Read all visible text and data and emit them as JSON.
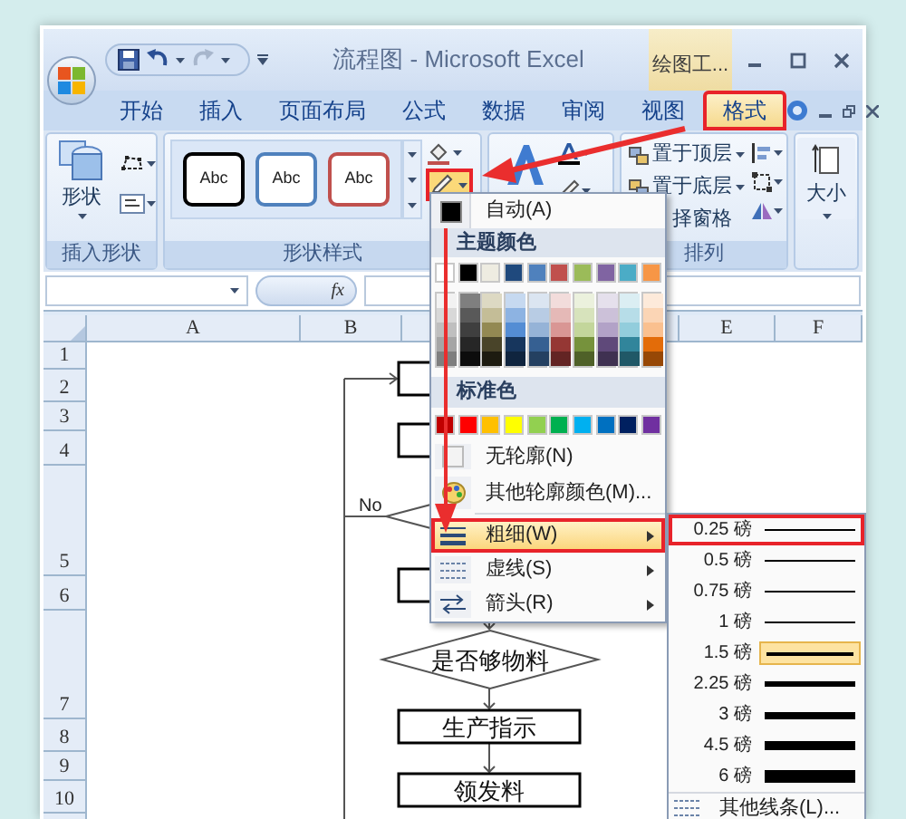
{
  "window": {
    "title": "流程图 - Microsoft Excel",
    "context_tab": "绘图工..."
  },
  "tabs": [
    {
      "label": "开始",
      "selected": false,
      "highlighted": false
    },
    {
      "label": "插入",
      "selected": false,
      "highlighted": false
    },
    {
      "label": "页面布局",
      "selected": false,
      "highlighted": false
    },
    {
      "label": "公式",
      "selected": false,
      "highlighted": false
    },
    {
      "label": "数据",
      "selected": false,
      "highlighted": false
    },
    {
      "label": "审阅",
      "selected": false,
      "highlighted": false
    },
    {
      "label": "视图",
      "selected": false,
      "highlighted": false
    },
    {
      "label": "格式",
      "selected": true,
      "highlighted": true
    }
  ],
  "ribbon": {
    "insert_shapes": {
      "shapes_label": "形状",
      "group_label": "插入形状"
    },
    "shape_styles": {
      "samples": [
        {
          "label": "Abc",
          "color": "#000000"
        },
        {
          "label": "Abc",
          "color": "#4f81bd"
        },
        {
          "label": "Abc",
          "color": "#c0504d"
        }
      ],
      "outline_highlighted": true,
      "group_label": "形状样式"
    },
    "arrange": {
      "items": [
        "置于顶层",
        "置于底层",
        "择窗格"
      ],
      "group_label": "排列"
    },
    "size": {
      "label": "大小"
    }
  },
  "formula_bar": {
    "fx_label": "fx"
  },
  "sheet": {
    "columns": [
      "A",
      "B",
      "E",
      "F"
    ],
    "rows": [
      "1",
      "2",
      "3",
      "4",
      "5",
      "6",
      "7",
      "8",
      "9",
      "10"
    ]
  },
  "flowchart": {
    "nodes": [
      {
        "kind": "box"
      },
      {
        "kind": "box"
      },
      {
        "kind": "decision"
      },
      {
        "kind": "box"
      },
      {
        "kind": "decision",
        "text": "是否够物料"
      },
      {
        "kind": "box",
        "text": "生产指示"
      },
      {
        "kind": "box",
        "text": "领发料"
      }
    ],
    "edge_label": "No"
  },
  "outline_menu": {
    "auto": {
      "label": "自动(A)",
      "color": "#000000"
    },
    "theme_header": "主题颜色",
    "theme_colors": [
      {
        "color": "#ffffff",
        "shades": [
          {
            "color": "#f2f2f2"
          },
          {
            "color": "#d8d8d8"
          },
          {
            "color": "#bfbfbf"
          },
          {
            "color": "#a5a5a5"
          },
          {
            "color": "#7f7f7f"
          }
        ]
      },
      {
        "color": "#000000",
        "shades": [
          {
            "color": "#7f7f7f"
          },
          {
            "color": "#595959"
          },
          {
            "color": "#3f3f3f"
          },
          {
            "color": "#262626"
          },
          {
            "color": "#0c0c0c"
          }
        ]
      },
      {
        "color": "#eeece1",
        "shades": [
          {
            "color": "#ddd9c3"
          },
          {
            "color": "#c4bd97"
          },
          {
            "color": "#938953"
          },
          {
            "color": "#494429"
          },
          {
            "color": "#1d1b10"
          }
        ]
      },
      {
        "color": "#1f497d",
        "shades": [
          {
            "color": "#c6d9f0"
          },
          {
            "color": "#8db3e2"
          },
          {
            "color": "#548dd4"
          },
          {
            "color": "#17365d"
          },
          {
            "color": "#0f243e"
          }
        ]
      },
      {
        "color": "#4f81bd",
        "shades": [
          {
            "color": "#dbe5f1"
          },
          {
            "color": "#b8cce4"
          },
          {
            "color": "#95b3d7"
          },
          {
            "color": "#366092"
          },
          {
            "color": "#244061"
          }
        ]
      },
      {
        "color": "#c0504d",
        "shades": [
          {
            "color": "#f2dcdb"
          },
          {
            "color": "#e5b9b7"
          },
          {
            "color": "#d99694"
          },
          {
            "color": "#953734"
          },
          {
            "color": "#632423"
          }
        ]
      },
      {
        "color": "#9bbb59",
        "shades": [
          {
            "color": "#ebf1dd"
          },
          {
            "color": "#d7e3bc"
          },
          {
            "color": "#c3d69b"
          },
          {
            "color": "#76923c"
          },
          {
            "color": "#4f6128"
          }
        ]
      },
      {
        "color": "#8064a2",
        "shades": [
          {
            "color": "#e5e0ec"
          },
          {
            "color": "#ccc1d9"
          },
          {
            "color": "#b2a2c7"
          },
          {
            "color": "#5f497a"
          },
          {
            "color": "#3f3151"
          }
        ]
      },
      {
        "color": "#4bacc6",
        "shades": [
          {
            "color": "#dbeef3"
          },
          {
            "color": "#b7dde8"
          },
          {
            "color": "#92cddc"
          },
          {
            "color": "#31859b"
          },
          {
            "color": "#205867"
          }
        ]
      },
      {
        "color": "#f79646",
        "shades": [
          {
            "color": "#fdeada"
          },
          {
            "color": "#fbd5b5"
          },
          {
            "color": "#fac08f"
          },
          {
            "color": "#e36c09"
          },
          {
            "color": "#974806"
          }
        ]
      }
    ],
    "standard_header": "标准色",
    "standard_colors": [
      {
        "color": "#c00000"
      },
      {
        "color": "#ff0000"
      },
      {
        "color": "#ffc000"
      },
      {
        "color": "#ffff00"
      },
      {
        "color": "#92d050"
      },
      {
        "color": "#00b050"
      },
      {
        "color": "#00b0f0"
      },
      {
        "color": "#0070c0"
      },
      {
        "color": "#002060"
      },
      {
        "color": "#7030a0"
      }
    ],
    "items": [
      {
        "kind": "none",
        "label": "无轮廓(N)",
        "open": false,
        "highlighted": false
      },
      {
        "kind": "more_colors",
        "label": "其他轮廓颜色(M)...",
        "open": false,
        "highlighted": false
      },
      {
        "kind": "weight",
        "label": "粗细(W)",
        "open": true,
        "highlighted": true
      },
      {
        "kind": "dash",
        "label": "虚线(S)",
        "open": false,
        "highlighted": false
      },
      {
        "kind": "arrow",
        "label": "箭头(R)",
        "open": false,
        "highlighted": false
      }
    ]
  },
  "weight_menu": {
    "items": [
      {
        "label": "0.25 磅",
        "selected": false,
        "highlighted": true
      },
      {
        "label": "0.5 磅",
        "selected": false,
        "highlighted": false
      },
      {
        "label": "0.75 磅",
        "selected": false,
        "highlighted": false
      },
      {
        "label": "1 磅",
        "selected": false,
        "highlighted": false
      },
      {
        "label": "1.5 磅",
        "selected": true,
        "highlighted": false
      },
      {
        "label": "2.25 磅",
        "selected": false,
        "highlighted": false
      },
      {
        "label": "3 磅",
        "selected": false,
        "highlighted": false
      },
      {
        "label": "4.5 磅",
        "selected": false,
        "highlighted": false
      },
      {
        "label": "6 磅",
        "selected": false,
        "highlighted": false
      }
    ],
    "more_label": "其他线条(L)..."
  }
}
